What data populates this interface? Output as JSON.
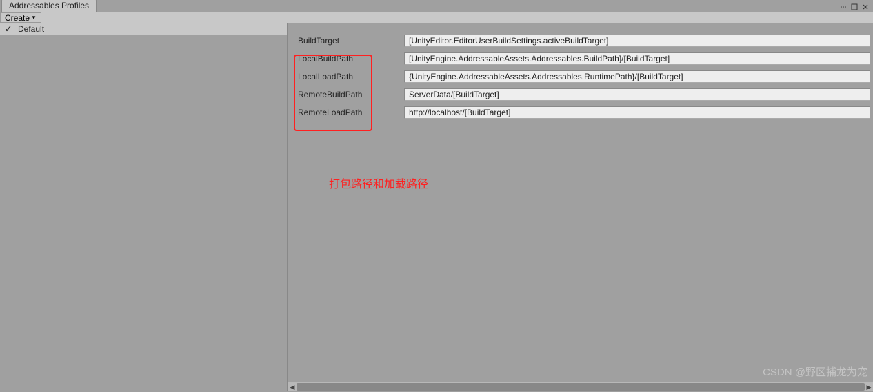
{
  "tab": {
    "title": "Addressables Profiles"
  },
  "toolbar": {
    "create_label": "Create"
  },
  "sidebar": {
    "items": [
      {
        "label": "Default",
        "active": true
      }
    ]
  },
  "fields": [
    {
      "label": "BuildTarget",
      "value": "[UnityEditor.EditorUserBuildSettings.activeBuildTarget]"
    },
    {
      "label": "LocalBuildPath",
      "value": "[UnityEngine.AddressableAssets.Addressables.BuildPath]/[BuildTarget]"
    },
    {
      "label": "LocalLoadPath",
      "value": "{UnityEngine.AddressableAssets.Addressables.RuntimePath}/[BuildTarget]"
    },
    {
      "label": "RemoteBuildPath",
      "value": "ServerData/[BuildTarget]"
    },
    {
      "label": "RemoteLoadPath",
      "value": "http://localhost/[BuildTarget]"
    }
  ],
  "annotation": "打包路径和加载路径",
  "watermark": "CSDN @野区捕龙为宠"
}
